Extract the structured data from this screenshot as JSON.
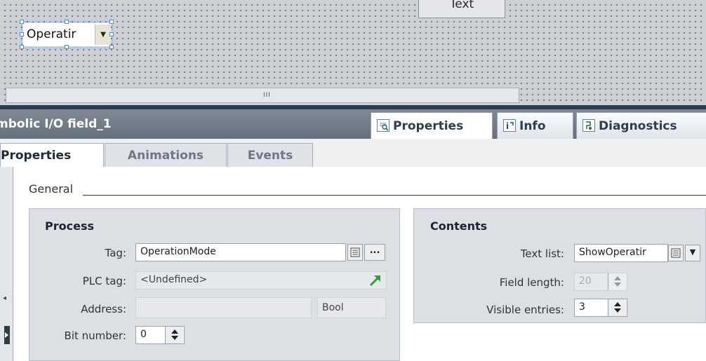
{
  "canvas": {
    "text_object_label": "Text",
    "io_field_text": "Operatir",
    "hscroll_grip": "III"
  },
  "inspector": {
    "object_title": "mbolic I/O field_1",
    "tabs": [
      {
        "label": "Properties"
      },
      {
        "label": "Info"
      },
      {
        "label": "Diagnostics"
      }
    ],
    "subtabs": [
      {
        "label": "Properties"
      },
      {
        "label": "Animations"
      },
      {
        "label": "Events"
      }
    ],
    "section_label": "General"
  },
  "process": {
    "title": "Process",
    "tag_label": "Tag:",
    "tag_value": "OperationMode",
    "tag_browse": "...",
    "plc_tag_label": "PLC tag:",
    "plc_tag_value": "<Undefined>",
    "address_label": "Address:",
    "address_value": "",
    "address_type": "Bool",
    "bit_number_label": "Bit number:",
    "bit_number_value": "0"
  },
  "contents": {
    "title": "Contents",
    "text_list_label": "Text list:",
    "text_list_value": "ShowOperatir",
    "field_length_label": "Field length:",
    "field_length_value": "20",
    "visible_entries_label": "Visible entries:",
    "visible_entries_value": "3"
  },
  "colors": {
    "inspector_header": "#6f7a86",
    "canvas_bg": "#cdd1d6",
    "group_bg": "#dcdfe3",
    "arrow_green": "#2e9e3a"
  }
}
